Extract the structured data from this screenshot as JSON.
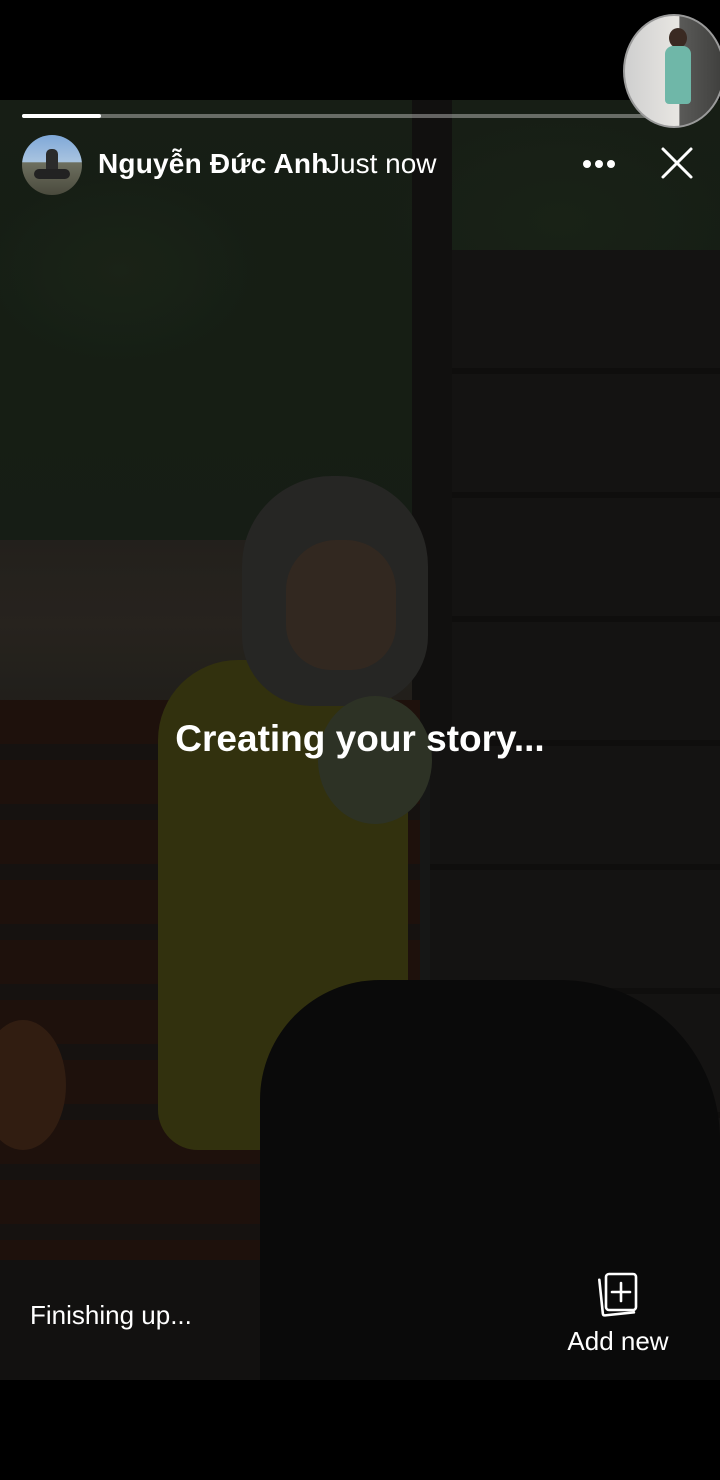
{
  "story": {
    "username": "Nguyễn Đức Anh",
    "timestamp": "Just now",
    "progress": 0.12,
    "status_center": "Creating your story...",
    "status_bottom": "Finishing up...",
    "add_new_label": "Add new",
    "icons": {
      "more": "more-options-icon",
      "close": "close-icon",
      "add_new": "add-stack-icon"
    }
  }
}
